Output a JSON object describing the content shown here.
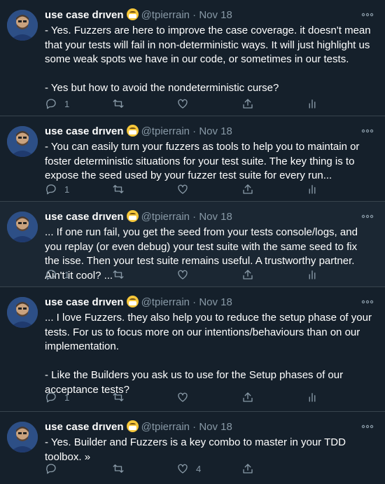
{
  "tweets": [
    {
      "name": "use case drıven",
      "handle": "@tpierrain",
      "separator": "·",
      "date": "Nov 18",
      "text": "- Yes. Fuzzers are here to improve the case coverage. it doesn't mean that your tests will fail in non-deterministic ways. It will just highlight us some weak spots we have in our code, or sometimes in our tests.\n\n- Yes but how to avoid the nondeterministic curse?",
      "reply_count": "1",
      "retweet_count": "",
      "like_count": ""
    },
    {
      "name": "use case drıven",
      "handle": "@tpierrain",
      "separator": "·",
      "date": "Nov 18",
      "text": "- You can easily turn your fuzzers as tools to help you to maintain or foster deterministic situations for your test suite. The key thing is to expose the seed used by your fuzzer test suite for every run...",
      "reply_count": "1",
      "retweet_count": "",
      "like_count": ""
    },
    {
      "name": "use case drıven",
      "handle": "@tpierrain",
      "separator": "·",
      "date": "Nov 18",
      "text": "... If one run fail, you get the seed from your tests console/logs, and you replay (or even debug) your test suite with the same seed to fix the isse. Then your test suite remains useful. A trustworthy partner. Ain't it cool? ...",
      "reply_count": "1",
      "retweet_count": "",
      "like_count": ""
    },
    {
      "name": "use case drıven",
      "handle": "@tpierrain",
      "separator": "·",
      "date": "Nov 18",
      "text": "... I love Fuzzers. they also help you to reduce the setup phase of your tests. For us to focus more on our intentions/behaviours than on our implementation.\n\n- Like the Builders you ask us to use for the Setup phases of our acceptance tests?",
      "reply_count": "1",
      "retweet_count": "",
      "like_count": ""
    },
    {
      "name": "use case drıven",
      "handle": "@tpierrain",
      "separator": "·",
      "date": "Nov 18",
      "text": "- Yes. Builder and Fuzzers is a key combo to master in your TDD toolbox. »",
      "reply_count": "",
      "retweet_count": "",
      "like_count": "4"
    }
  ],
  "icons": {
    "reply": "reply-icon",
    "retweet": "retweet-icon",
    "like": "like-icon",
    "share": "share-icon",
    "analytics": "analytics-icon",
    "more": "more-icon"
  },
  "colors": {
    "background": "#15202b",
    "highlight_background": "#1b2733",
    "secondary_text": "#8899a6",
    "divider": "#38444d"
  }
}
